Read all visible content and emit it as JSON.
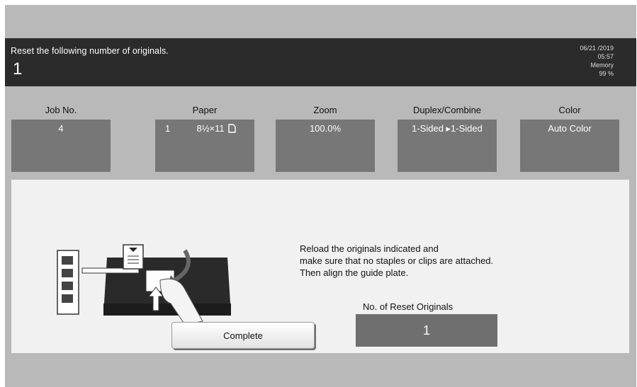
{
  "header": {
    "message": "Reset the following number of originals.",
    "count": "1",
    "status": {
      "date": "06/21 /2019",
      "time": "05:57",
      "memory_label": "Memory",
      "memory_value": "99 %"
    }
  },
  "job_info": {
    "job_no": {
      "title": "Job No.",
      "value": "4"
    },
    "paper": {
      "title": "Paper",
      "tray": "1",
      "size": "8½×11"
    },
    "zoom": {
      "title": "Zoom",
      "value": "100.0%"
    },
    "duplex": {
      "title": "Duplex/Combine",
      "value": "1-Sided ▸1-Sided"
    },
    "color": {
      "title": "Color",
      "value": "Auto Color"
    }
  },
  "panel": {
    "instructions": [
      "Reload the originals indicated and",
      "make sure that no staples or clips are attached.",
      "Then align the guide plate."
    ],
    "reset_originals_label": "No. of Reset Originals",
    "reset_originals_value": "1",
    "complete_button": "Complete"
  },
  "icons": {
    "paper_orientation": "portrait-page-icon",
    "illustration": "adf-reload-originals-illustration"
  }
}
